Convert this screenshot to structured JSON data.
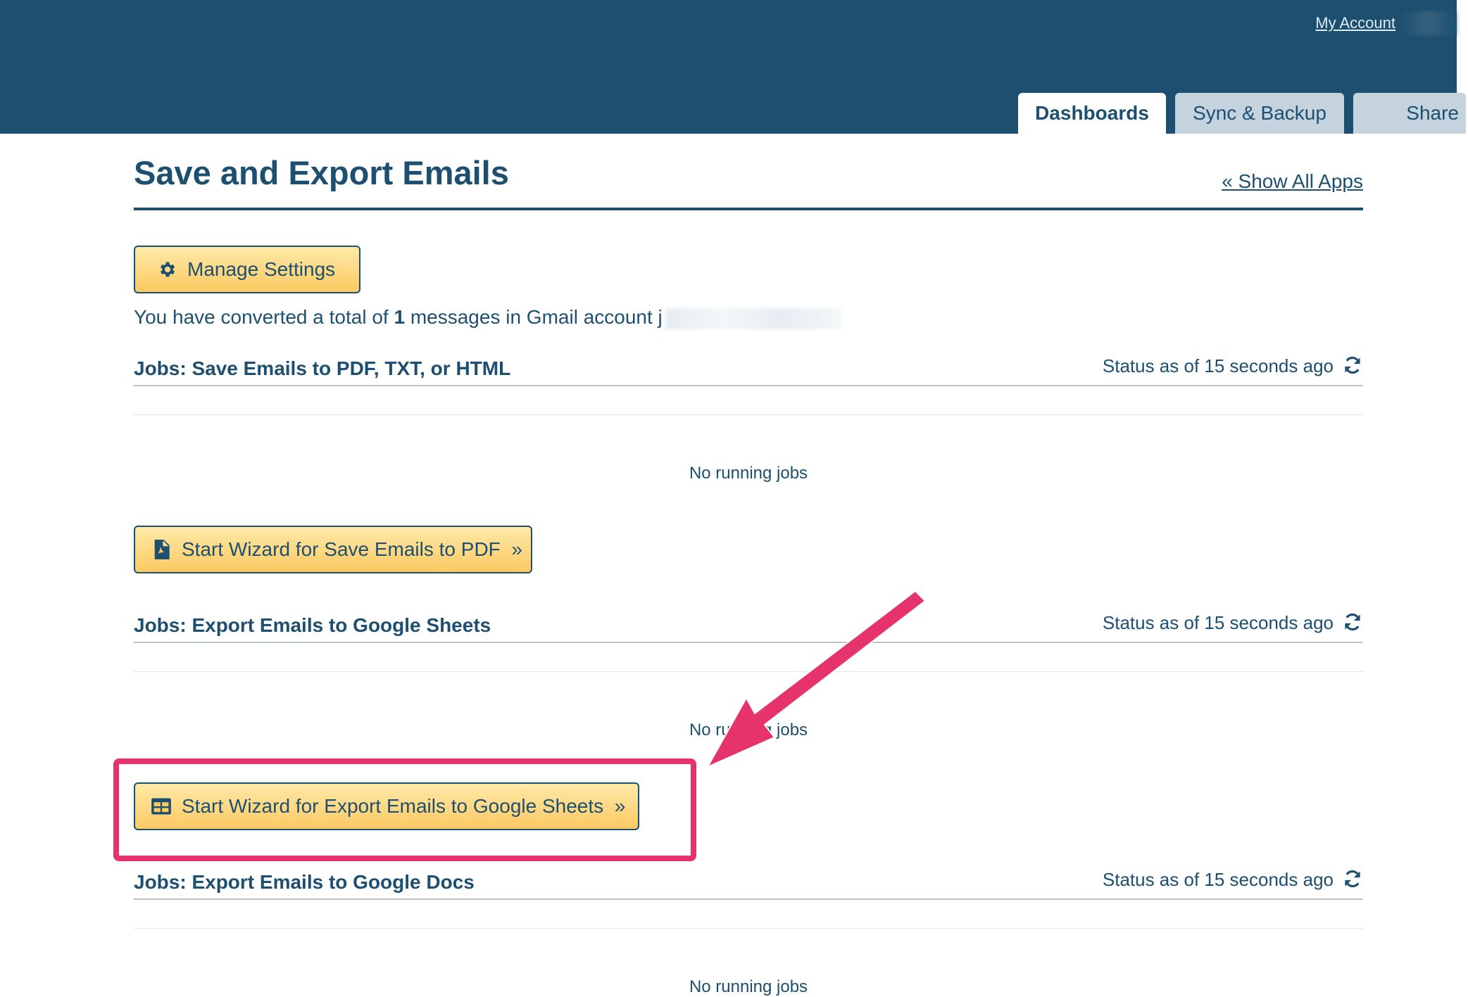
{
  "header": {
    "my_account": "My Account",
    "tabs": [
      {
        "label": "Dashboards",
        "active": true
      },
      {
        "label": "Sync & Backup",
        "active": false
      },
      {
        "label": "Share",
        "active": false
      }
    ]
  },
  "page": {
    "title": "Save and Export Emails",
    "show_all_apps": "« Show All Apps",
    "manage_settings": "Manage Settings",
    "summary_prefix": "You have converted a total of ",
    "summary_count": "1",
    "summary_suffix": " messages in Gmail account j"
  },
  "sections": [
    {
      "title": "Jobs: Save Emails to PDF, TXT, or HTML",
      "status": "Status as of 15 seconds ago",
      "empty_text": "No running jobs",
      "button": "Start Wizard for Save Emails to PDF  »"
    },
    {
      "title": "Jobs: Export Emails to Google Sheets",
      "status": "Status as of 15 seconds ago",
      "empty_text": "No running jobs",
      "button": "Start Wizard for Export Emails to Google Sheets  »"
    },
    {
      "title": "Jobs: Export Emails to Google Docs",
      "status": "Status as of 15 seconds ago",
      "empty_text": "No running jobs"
    }
  ],
  "colors": {
    "header_bg": "#1c4f70",
    "button_bg": "#fcc962",
    "highlight": "#e6336b"
  }
}
